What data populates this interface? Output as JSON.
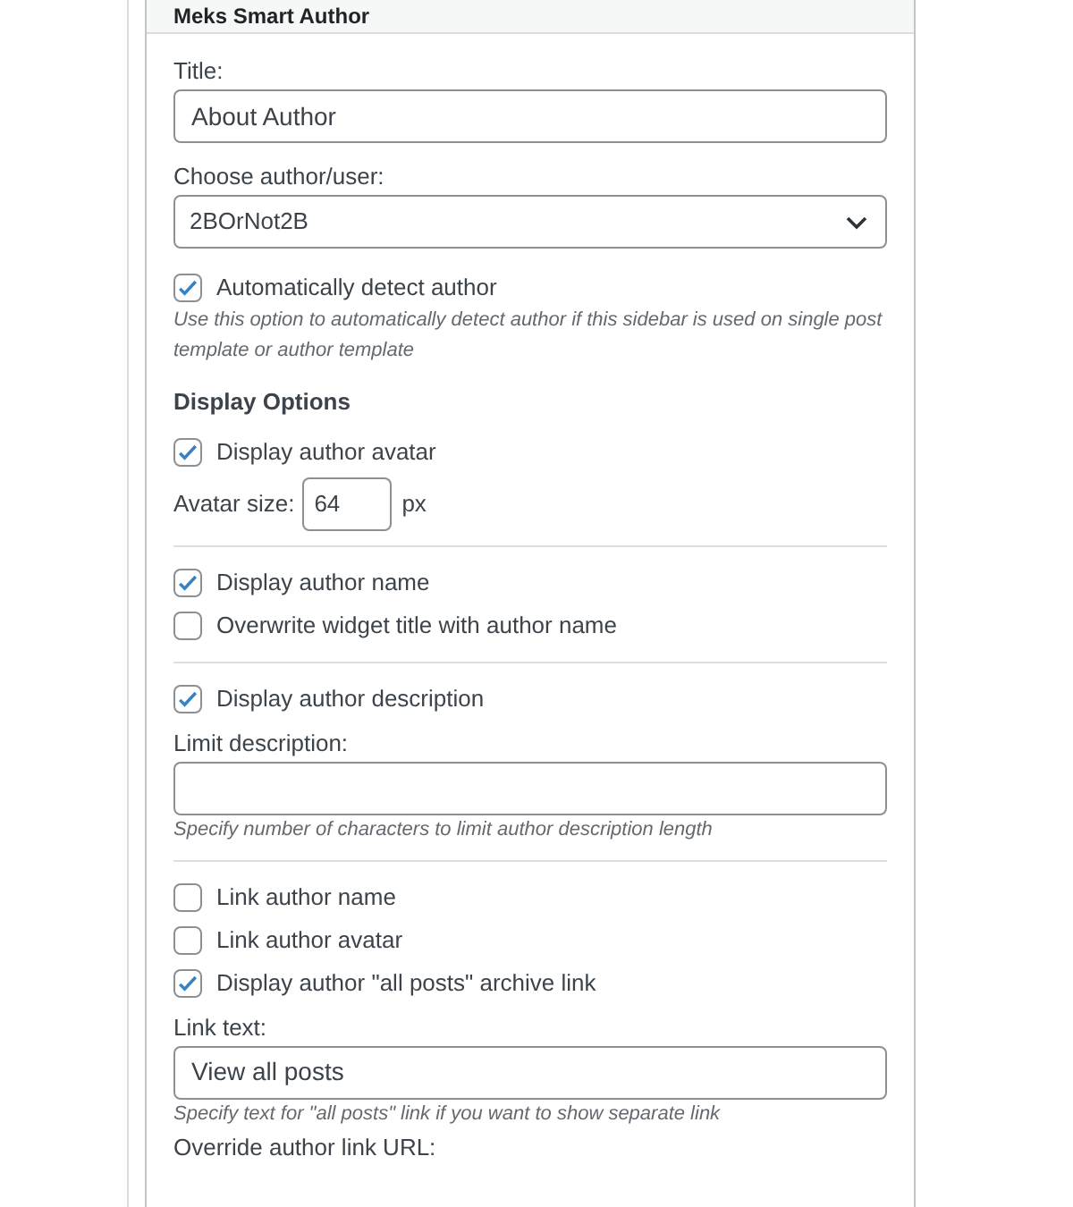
{
  "widget": {
    "title": "Meks Smart Author"
  },
  "fields": [
    {
      "kind": "text",
      "label": "Title:",
      "value": "About Author"
    },
    {
      "kind": "select",
      "label": "Choose author/user:",
      "value": "2BOrNot2B"
    },
    {
      "kind": "checkbox",
      "label": "Automatically detect author",
      "checked": true
    },
    {
      "kind": "hint",
      "text": "Use this option to automatically detect author if this sidebar is used on single post template or author template"
    },
    {
      "kind": "heading",
      "text": "Display Options"
    },
    {
      "kind": "checkbox",
      "label": "Display author avatar",
      "checked": true
    },
    {
      "kind": "number",
      "label": "Avatar size:",
      "value": "64",
      "unit": "px"
    },
    {
      "kind": "divider"
    },
    {
      "kind": "checkbox",
      "label": "Display author name",
      "checked": true
    },
    {
      "kind": "checkbox",
      "label": "Overwrite widget title with author name",
      "checked": false
    },
    {
      "kind": "divider"
    },
    {
      "kind": "checkbox",
      "label": "Display author description",
      "checked": true
    },
    {
      "kind": "text",
      "label": "Limit description:"
    },
    {
      "kind": "hint",
      "text": "Specify number of characters to limit author description length"
    },
    {
      "kind": "divider"
    },
    {
      "kind": "checkbox",
      "label": "Link author name",
      "checked": false
    },
    {
      "kind": "checkbox",
      "label": "Link author avatar",
      "checked": false
    },
    {
      "kind": "checkbox",
      "label": "Display author \"all posts\" archive link",
      "checked": true
    },
    {
      "kind": "text",
      "label": "Link text:",
      "value": "View all posts"
    },
    {
      "kind": "hint",
      "text": "Specify text for \"all posts\" link if you want to show separate link"
    },
    {
      "kind": "label",
      "text": "Override author link URL:"
    }
  ]
}
